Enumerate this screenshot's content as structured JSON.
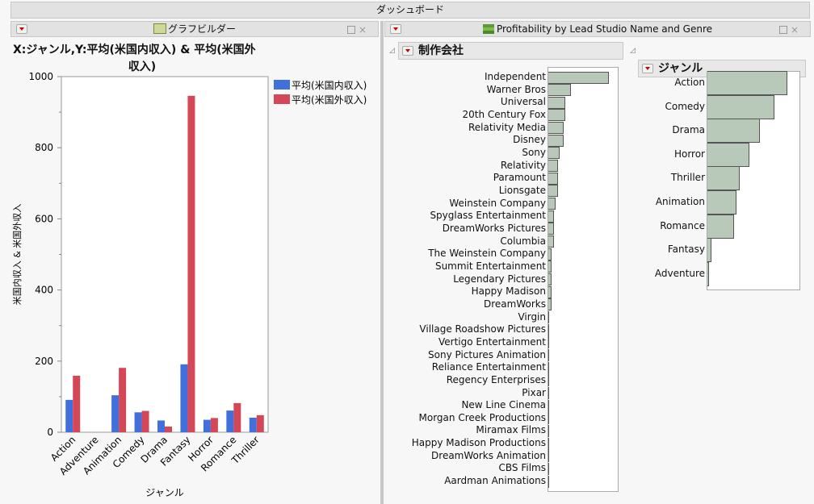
{
  "dashboard_title": "ダッシュボード",
  "left_panel": {
    "title": "グラフビルダー",
    "chart_title_line1": "X:ジャンル,Y:平均(米国内収入) & 平均(米国外",
    "chart_title_line2": "収入)"
  },
  "right_panel": {
    "title": "Profitability by Lead Studio Name and Genre",
    "studio_section": "制作会社",
    "genre_section": "ジャンル"
  },
  "colors": {
    "domestic": "#4170dd",
    "foreign": "#d44757",
    "bar": "#b9c9b9"
  },
  "chart_data": [
    {
      "type": "bar",
      "title": "X:ジャンル,Y:平均(米国内収入) & 平均(米国外収入)",
      "xlabel": "ジャンル",
      "ylabel": "米国内収入 & 米国外収入",
      "ylim": [
        0,
        1000
      ],
      "yticks": [
        "0",
        "200",
        "400",
        "600",
        "800",
        "1000"
      ],
      "categories": [
        "Action",
        "Adventure",
        "Animation",
        "Comedy",
        "Drama",
        "Fantasy",
        "Horror",
        "Romance",
        "Thriller"
      ],
      "series": [
        {
          "name": "平均(米国内収入)",
          "values": [
            91,
            0,
            104,
            56,
            33,
            191,
            35,
            61,
            41
          ]
        },
        {
          "name": "平均(米国外収入)",
          "values": [
            159,
            0,
            181,
            60,
            16,
            946,
            40,
            82,
            48
          ]
        }
      ],
      "legend": "right"
    },
    {
      "type": "bar",
      "orientation": "horizontal",
      "title": "制作会社",
      "categories": [
        "Independent",
        "Warner Bros",
        "Universal",
        "20th Century Fox",
        "Relativity Media",
        "Disney",
        "Sony",
        "Relativity",
        "Paramount",
        "Lionsgate",
        "Weinstein Company",
        "Spyglass Entertainment",
        "DreamWorks Pictures",
        "Columbia",
        "The Weinstein Company",
        "Summit Entertainment",
        "Legendary Pictures",
        "Happy Madison",
        "DreamWorks",
        "Virgin",
        "Village Roadshow Pictures",
        "Vertigo Entertainment",
        "Sony Pictures Animation",
        "Reliance Entertainment",
        "Regency Enterprises",
        "Pixar",
        "New Line Cinema",
        "Morgan Creek Productions",
        "Miramax Films",
        "Happy Madison Productions",
        "DreamWorks Animation",
        "CBS Films",
        "Aardman Animations"
      ],
      "values": [
        75,
        28,
        21,
        21,
        19,
        19,
        14,
        12,
        12,
        12,
        9,
        7,
        7,
        7,
        4,
        4,
        4,
        4,
        4,
        1,
        1,
        1,
        1,
        1,
        1,
        1,
        1,
        1,
        1,
        1,
        1,
        1,
        1
      ]
    },
    {
      "type": "bar",
      "orientation": "horizontal",
      "title": "ジャンル",
      "categories": [
        "Action",
        "Comedy",
        "Drama",
        "Horror",
        "Thriller",
        "Animation",
        "Romance",
        "Fantasy",
        "Adventure"
      ],
      "values": [
        99,
        83,
        65,
        52,
        40,
        36,
        33,
        5,
        2
      ]
    }
  ]
}
